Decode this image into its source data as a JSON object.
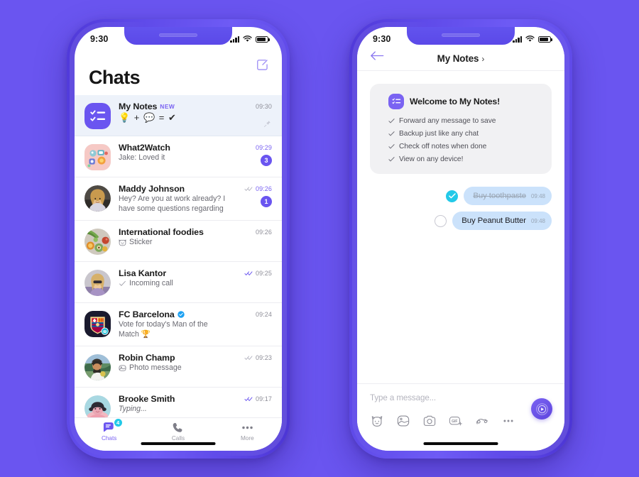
{
  "theme": {
    "background": "#6A55F0",
    "frame": "#5B46E6",
    "accent": "#7A63F2",
    "badge_purple": "#6A55F0",
    "badge_cyan": "#23C9E8",
    "bubble_blue": "#CBE2FB",
    "pinned_row": "#EDF2FA",
    "card_gray": "#F1F1F3"
  },
  "left_phone": {
    "status_bar": {
      "time": "9:30",
      "icons": [
        "signal-icon",
        "wifi-icon",
        "battery-icon"
      ]
    },
    "header": {
      "title": "Chats",
      "compose_icon": "compose-icon"
    },
    "chats": [
      {
        "name": "My Notes",
        "tag": "NEW",
        "preview": "💡 + 💬 = ✔",
        "preview_type": "emoji",
        "time": "09:30",
        "time_accent": false,
        "ticks": "none",
        "badge": null,
        "pinned": true,
        "avatar": "my-notes-icon",
        "verified": false,
        "sub_icon": null
      },
      {
        "name": "What2Watch",
        "tag": null,
        "preview": "Jake: Loved it",
        "preview_type": "text",
        "time": "09:29",
        "time_accent": true,
        "ticks": "none",
        "badge": "3",
        "pinned": false,
        "avatar": "what2watch-avatar",
        "verified": false,
        "sub_icon": null
      },
      {
        "name": "Maddy Johnson",
        "tag": null,
        "preview": "Hey? Are you at work already? I have some questions regarding",
        "preview_type": "text",
        "time": "09:26",
        "time_accent": true,
        "ticks": "double-gray",
        "badge": "1",
        "pinned": false,
        "avatar": "maddy-avatar",
        "verified": false,
        "sub_icon": null
      },
      {
        "name": "International foodies",
        "tag": null,
        "preview": "Sticker",
        "preview_type": "text",
        "time": "09:26",
        "time_accent": false,
        "ticks": "none",
        "badge": null,
        "pinned": false,
        "avatar": "foodies-avatar",
        "verified": false,
        "sub_icon": "sticker-icon"
      },
      {
        "name": "Lisa Kantor",
        "tag": null,
        "preview": "Incoming call",
        "preview_type": "text",
        "time": "09:25",
        "time_accent": false,
        "ticks": "double-purple",
        "badge": null,
        "pinned": false,
        "avatar": "lisa-avatar",
        "verified": false,
        "sub_icon": "call-arrow-icon"
      },
      {
        "name": "FC Barcelona",
        "tag": null,
        "preview": "Vote for today's Man of the Match 🏆",
        "preview_type": "text",
        "time": "09:24",
        "time_accent": false,
        "ticks": "none",
        "badge": null,
        "pinned": false,
        "avatar": "fcbarcelona-avatar",
        "verified": true,
        "sub_icon": null
      },
      {
        "name": "Robin Champ",
        "tag": null,
        "preview": "Photo message",
        "preview_type": "text",
        "time": "09:23",
        "time_accent": false,
        "ticks": "double-gray",
        "badge": null,
        "pinned": false,
        "avatar": "robin-avatar",
        "verified": false,
        "sub_icon": "photo-icon"
      },
      {
        "name": "Brooke Smith",
        "tag": null,
        "preview": "Typing...",
        "preview_type": "italic",
        "time": "09:17",
        "time_accent": false,
        "ticks": "double-purple",
        "badge": null,
        "pinned": false,
        "avatar": "brooke-avatar",
        "verified": false,
        "sub_icon": null
      }
    ],
    "tabbar": [
      {
        "label": "Chats",
        "icon": "chats-icon",
        "badge": "4",
        "active": true
      },
      {
        "label": "Calls",
        "icon": "phone-icon",
        "badge": null,
        "active": false
      },
      {
        "label": "More",
        "icon": "more-dots-icon",
        "badge": null,
        "active": false
      }
    ]
  },
  "right_phone": {
    "status_bar": {
      "time": "9:30",
      "icons": [
        "signal-icon",
        "wifi-icon",
        "battery-icon"
      ]
    },
    "header": {
      "back_icon": "back-arrow-icon",
      "title": "My Notes",
      "chevron": "›"
    },
    "welcome_card": {
      "icon": "my-notes-icon",
      "title": "Welcome to My Notes!",
      "items": [
        "Forward any message to save",
        "Backup just like any chat",
        "Check off notes when done",
        "View on any device!"
      ]
    },
    "messages": [
      {
        "text": "Buy toothpaste",
        "time": "09:48",
        "checked": true
      },
      {
        "text": "Buy Peanut Butter",
        "time": "09:48",
        "checked": false
      }
    ],
    "composer": {
      "placeholder": "Type a message...",
      "icons": [
        "sticker-cat-icon",
        "gallery-icon",
        "camera-icon",
        "gif-icon",
        "doodle-icon",
        "more-dots-icon"
      ],
      "send_button": "voice-send-icon"
    }
  }
}
